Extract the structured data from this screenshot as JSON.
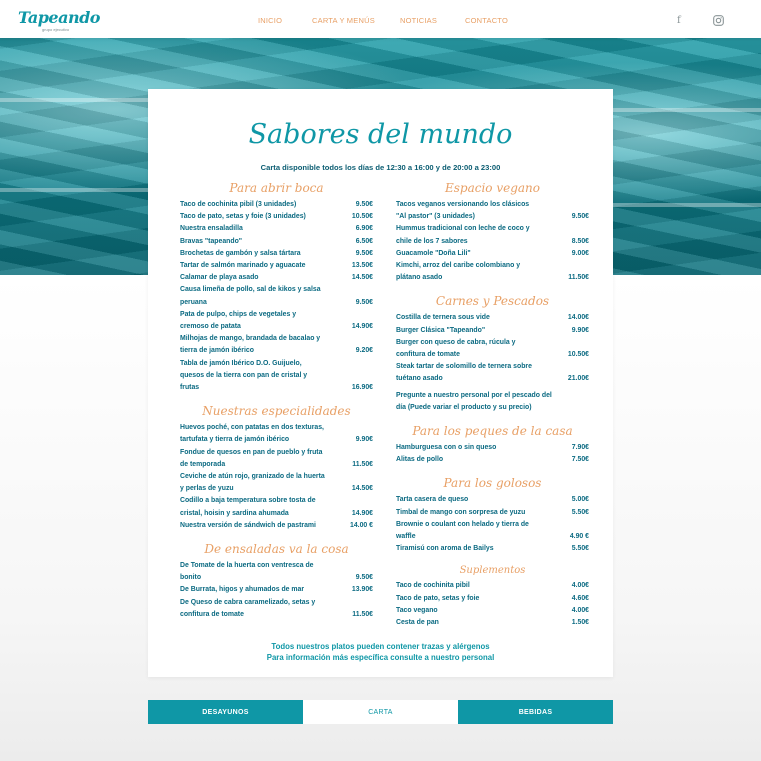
{
  "brand": {
    "logo_text": "Tapeando",
    "logo_sub": "grupo ejecutivo"
  },
  "nav": {
    "items": [
      {
        "label": "INICIO",
        "active": false
      },
      {
        "label": "CARTA Y MENÚS",
        "active": true
      },
      {
        "label": "NOTICIAS",
        "active": false
      },
      {
        "label": "CONTACTO",
        "active": false
      }
    ],
    "social": {
      "facebook_icon": "f",
      "instagram_icon": "◎"
    }
  },
  "menu": {
    "title": "Sabores del mundo",
    "subtitle": "Carta disponible todos los días de 12:30 a 16:00 y de 20:00 a 23:00",
    "left_sections": [
      {
        "title": "Para abrir boca",
        "items": [
          {
            "name": "Taco de cochinita pibil (3 unidades)",
            "price": "9.50€"
          },
          {
            "name": "Taco de pato, setas y foie (3 unidades)",
            "price": "10.50€"
          },
          {
            "name": "Nuestra ensaladilla",
            "price": "6.90€"
          },
          {
            "name": "Bravas \"tapeando\"",
            "price": "6.50€"
          },
          {
            "name": "Brochetas de gambón y salsa tártara",
            "price": "9.50€"
          },
          {
            "name": "Tartar de salmón marinado y aguacate",
            "price": "13.50€"
          },
          {
            "name": "Calamar de playa asado",
            "price": "14.50€"
          },
          {
            "name": "Causa limeña de pollo, sal de kikos y salsa peruana",
            "price": "9.50€"
          },
          {
            "name": "Pata de pulpo, chips de vegetales y cremoso de patata",
            "price": "14.90€"
          },
          {
            "name": "Milhojas de mango, brandada de bacalao y tierra de jamón ibérico",
            "price": "9.20€"
          },
          {
            "name": "Tabla de jamón Ibérico D.O. Guijuelo, quesos de la tierra con pan de cristal y frutas",
            "price": "16.90€"
          }
        ]
      },
      {
        "title": "Nuestras especialidades",
        "items": [
          {
            "name": "Huevos poché, con patatas en dos texturas, tartufata y tierra de jamón ibérico",
            "price": "9.90€"
          },
          {
            "name": "Fondue de quesos en pan de pueblo y fruta de temporada",
            "price": "11.50€"
          },
          {
            "name": "Ceviche de atún rojo, granizado de la huerta y perlas de yuzu",
            "price": "14.50€"
          },
          {
            "name": "Codillo a baja temperatura sobre tosta de cristal, hoisin y sardina ahumada",
            "price": "14.90€"
          },
          {
            "name": "Nuestra versión de sándwich de pastrami",
            "price": "14.00 €"
          }
        ]
      },
      {
        "title": "De ensaladas va la cosa",
        "items": [
          {
            "name": "De Tomate de la huerta con ventresca de bonito",
            "price": "9.50€"
          },
          {
            "name": "De Burrata, higos y ahumados de mar",
            "price": "13.90€"
          },
          {
            "name": "De Queso de cabra caramelizado, setas y confitura de tomate",
            "price": "11.50€"
          }
        ]
      }
    ],
    "right_sections": [
      {
        "title": "Espacio vegano",
        "items": [
          {
            "name": "Tacos veganos versionando los clásicos \"Al pastor\" (3 unidades)",
            "price": "9.50€"
          },
          {
            "name": "Hummus tradicional con leche de coco y chile de los 7 sabores",
            "price": "8.50€"
          },
          {
            "name": "Guacamole \"Doña Lili\"",
            "price": "9.00€"
          },
          {
            "name": "Kimchi, arroz del caribe colombiano y plátano asado",
            "price": "11.50€"
          }
        ]
      },
      {
        "title": "Carnes y Pescados",
        "items": [
          {
            "name": "Costilla de ternera sous vide",
            "price": "14.00€"
          },
          {
            "name": "Burger Clásica \"Tapeando\"",
            "price": "9.90€"
          },
          {
            "name": "Burger con queso de cabra, rúcula y confitura de tomate",
            "price": "10.50€"
          },
          {
            "name": "Steak tartar de solomillo de ternera sobre tuétano asado",
            "price": "21.00€"
          }
        ],
        "note": "Pregunte a nuestro personal por el pescado del día (Puede variar el producto y su precio)"
      },
      {
        "title": "Para los peques de la casa",
        "items": [
          {
            "name": "Hamburguesa con o sin queso",
            "price": "7.90€"
          },
          {
            "name": "Alitas de pollo",
            "price": "7.50€"
          }
        ]
      },
      {
        "title": "Para los golosos",
        "items": [
          {
            "name": "Tarta casera de queso",
            "price": "5.00€"
          },
          {
            "name": "Timbal de mango con sorpresa de yuzu",
            "price": "5.50€"
          },
          {
            "name": "Brownie o coulant con helado y tierra de waffle",
            "price": "4.90 €"
          },
          {
            "name": "Tiramisú con aroma de Bailys",
            "price": "5.50€"
          }
        ]
      },
      {
        "title": "Suplementos",
        "small": true,
        "items": [
          {
            "name": "Taco de cochinita pibil",
            "price": "4.00€"
          },
          {
            "name": "Taco de pato, setas y foie",
            "price": "4.60€"
          },
          {
            "name": "Taco vegano",
            "price": "4.00€"
          },
          {
            "name": "Cesta de pan",
            "price": "1.50€"
          }
        ]
      }
    ],
    "footer_line1": "Todos nuestros platos pueden contener trazas y alérgenos",
    "footer_line2": "Para información más específica consulte a nuestro personal"
  },
  "tabs": [
    {
      "label": "DESAYUNOS",
      "active": false
    },
    {
      "label": "CARTA",
      "active": true
    },
    {
      "label": "BEBIDAS",
      "active": false
    }
  ],
  "colors": {
    "teal": "#0f97a6",
    "orange": "#e8a066",
    "dark_teal": "#0b6a82"
  }
}
